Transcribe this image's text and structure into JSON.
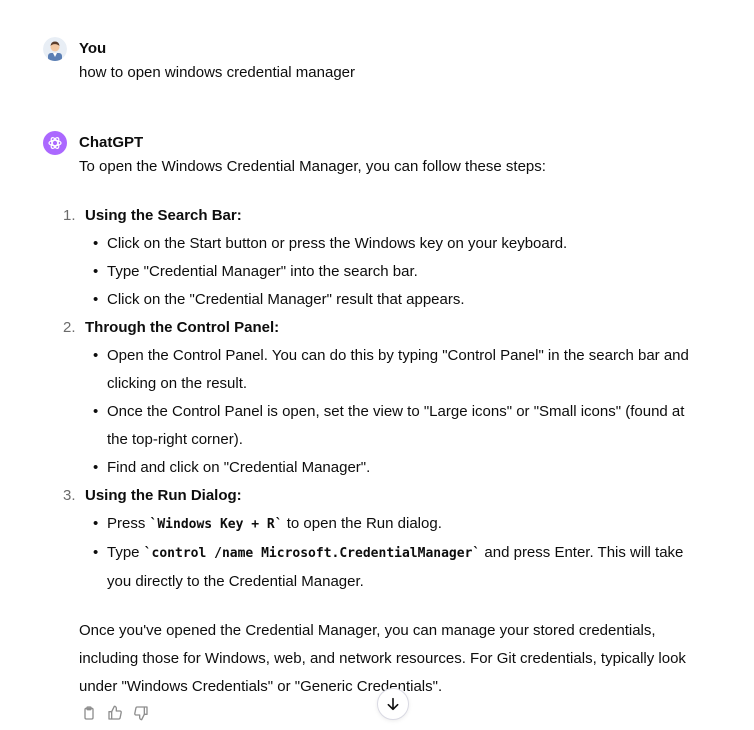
{
  "colors": {
    "bot_avatar_bg": "#ab68ff",
    "text": "#0d0d0d",
    "muted": "#8e8e8e"
  },
  "user_message": {
    "author": "You",
    "avatar_icon": "user-avatar",
    "text": "how to open windows credential manager"
  },
  "bot_message": {
    "author": "ChatGPT",
    "avatar_icon": "openai-logo-icon",
    "intro": "To open the Windows Credential Manager, you can follow these steps:",
    "steps": [
      {
        "num": "1.",
        "title": "Using the Search Bar:",
        "bullets": [
          "Click on the Start button or press the Windows key on your keyboard.",
          "Type \"Credential Manager\" into the search bar.",
          "Click on the \"Credential Manager\" result that appears."
        ]
      },
      {
        "num": "2.",
        "title": "Through the Control Panel:",
        "bullets": [
          "Open the Control Panel. You can do this by typing \"Control Panel\" in the search bar and clicking on the result.",
          "Once the Control Panel is open, set the view to \"Large icons\" or \"Small icons\" (found at the top-right corner).",
          "Find and click on \"Credential Manager\"."
        ]
      },
      {
        "num": "3.",
        "title": "Using the Run Dialog:",
        "bullets_rich": [
          {
            "pre": "Press ",
            "code": "`Windows Key + R`",
            "post": " to open the Run dialog."
          },
          {
            "pre": "Type ",
            "code": "`control /name Microsoft.CredentialManager`",
            "post": " and press Enter. This will take you directly to the Credential Manager."
          }
        ]
      }
    ],
    "outro": "Once you've opened the Credential Manager, you can manage your stored credentials, including those for Windows, web, and network resources. For Git credentials, typically look under \"Windows Credentials\" or \"Generic Credentials\".",
    "actions": [
      "copy-icon",
      "thumbs-up-icon",
      "thumbs-down-icon"
    ]
  },
  "scroll_button_icon": "arrow-down-icon"
}
